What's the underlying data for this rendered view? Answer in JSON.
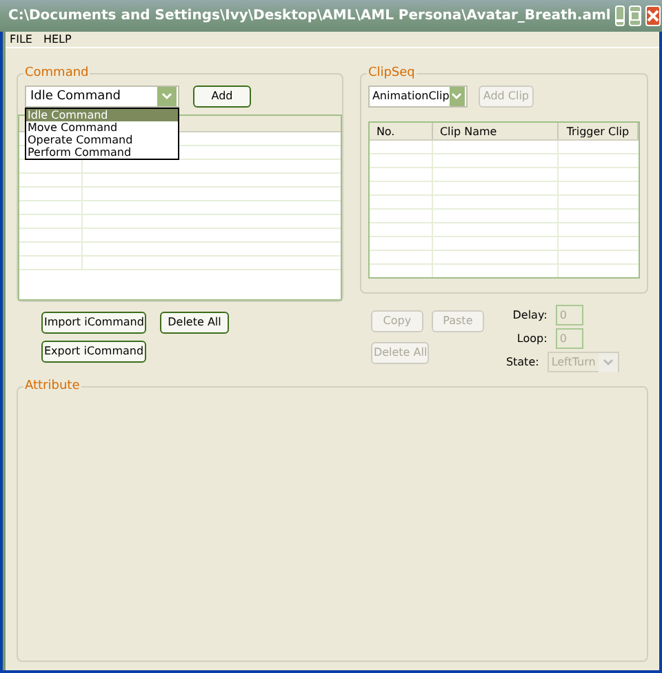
{
  "window": {
    "title": "C:\\Documents and Settings\\Ivy\\Desktop\\AML\\AML Persona\\Avatar_Breath.aml"
  },
  "menu": [
    "FILE",
    "HELP"
  ],
  "command": {
    "title": "Command",
    "combo": {
      "value": "Idle Command",
      "expanded": true,
      "options": [
        {
          "label": "Idle Command",
          "selected": true
        },
        {
          "label": "Move Command",
          "selected": false
        },
        {
          "label": "Operate Command",
          "selected": false
        },
        {
          "label": "Perform Command",
          "selected": false
        }
      ]
    },
    "add_button": {
      "label": "Add",
      "disabled": false
    },
    "buttons": [
      {
        "label": "Import iCommand",
        "disabled": false
      },
      {
        "label": "Delete All",
        "disabled": false
      },
      {
        "label": "Export iCommand",
        "disabled": false
      }
    ]
  },
  "clipseq": {
    "title": "ClipSeq",
    "combo": {
      "value": "AnimationClip"
    },
    "add_button": {
      "label": "Add Clip",
      "disabled": true
    },
    "columns": [
      "No.",
      "Clip Name",
      "Trigger Clip"
    ],
    "buttons": [
      {
        "label": "Copy",
        "disabled": true
      },
      {
        "label": "Paste",
        "disabled": true
      },
      {
        "label": "Delete All",
        "disabled": true
      }
    ],
    "fields": [
      {
        "label": "Delay:",
        "value": "0",
        "disabled": true
      },
      {
        "label": "Loop:",
        "value": "0",
        "disabled": true
      }
    ],
    "state": {
      "label": "State:",
      "value": "LeftTurn",
      "disabled": true
    }
  },
  "attribute": {
    "title": "Attribute"
  }
}
